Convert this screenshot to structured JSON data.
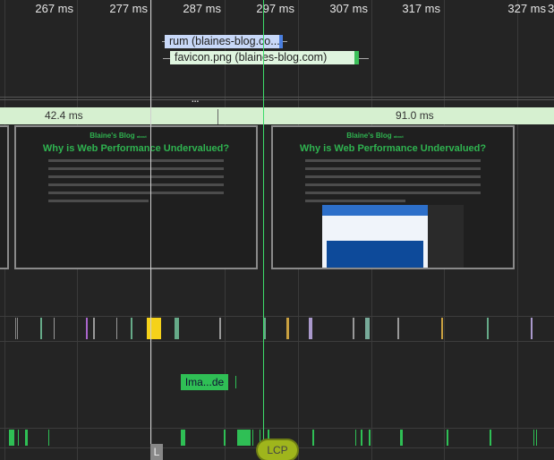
{
  "ruler": {
    "ticks": [
      "267 ms",
      "277 ms",
      "287 ms",
      "297 ms",
      "307 ms",
      "317 ms",
      "327 ms",
      "3"
    ]
  },
  "network": {
    "requests": [
      {
        "label": "rum (blaines-blog.co...",
        "color": "#c8d8f8",
        "accent": "#4a7fe0"
      },
      {
        "label": "favicon.png (blaines-blog.com)",
        "color": "#dff5df",
        "accent": "#3cc05a"
      }
    ]
  },
  "collapse_handle": "...",
  "frames": {
    "items": [
      "42.4 ms",
      "91.0 ms"
    ],
    "color": "#d6f0d0"
  },
  "screenshots": [
    {
      "blog_name": "Blaine's Blog",
      "blog_tag": "about",
      "title": "Why is Web Performance Undervalued?"
    },
    {
      "blog_name": "Blaine's Blog",
      "blog_tag": "about",
      "title": "Why is Web Performance Undervalued?"
    }
  ],
  "interactions": {
    "label": "Ima...de"
  },
  "markers": {
    "load": "L",
    "lcp": "LCP"
  },
  "colors": {
    "cursor_line": "#cfcfcf",
    "lcp_line": "#3ddc6a",
    "task": "#2fbf55",
    "highlight": "#f5d21a"
  }
}
